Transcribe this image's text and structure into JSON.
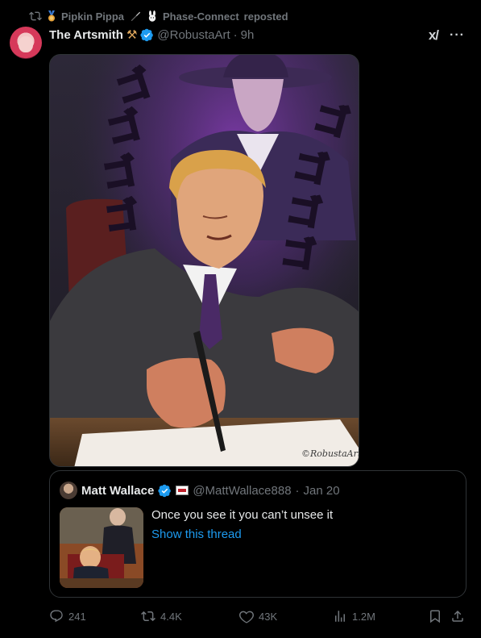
{
  "repost": {
    "reposter_1": "Pipkin Pippa",
    "reposter_2": "Phase-Connect",
    "suffix": "reposted"
  },
  "tweet": {
    "author_name": "The Artsmith",
    "author_emoji": "⚒",
    "handle": "@RobustaArt",
    "separator": "·",
    "time": "9h",
    "grok_label": "x/",
    "more_label": "···",
    "image_signature": "©RobustaArt"
  },
  "quote": {
    "author_name": "Matt Wallace",
    "handle": "@MattWallace888",
    "separator": "·",
    "date": "Jan 20",
    "text": "Once you see it you can’t unsee it",
    "link": "Show this thread"
  },
  "actions": {
    "replies": "241",
    "reposts": "4.4K",
    "likes": "43K",
    "views": "1.2M"
  },
  "colors": {
    "background": "#000000",
    "text": "#e7e9ea",
    "muted": "#71767b",
    "accent": "#1d9bf0",
    "border": "#2f3336"
  }
}
